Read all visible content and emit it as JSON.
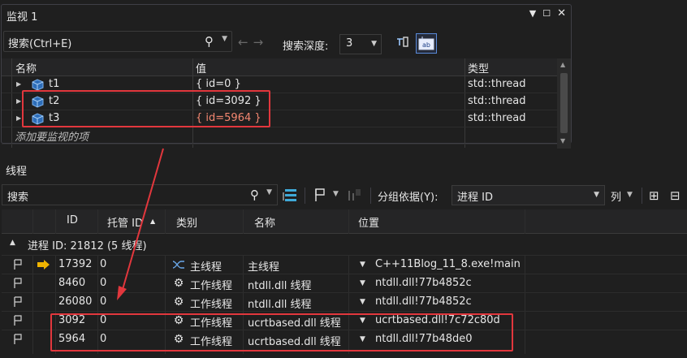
{
  "watch": {
    "title": "监视 1",
    "search_placeholder": "搜索(Ctrl+E)",
    "depth_label": "搜索深度:",
    "depth_value": "3",
    "columns": {
      "name": "名称",
      "value": "值",
      "type": "类型"
    },
    "rows": [
      {
        "name": "t1",
        "value": "{ id=0 }",
        "type": "std::thread",
        "changed": false
      },
      {
        "name": "t2",
        "value": "{ id=3092 }",
        "type": "std::thread",
        "changed": false
      },
      {
        "name": "t3",
        "value": "{ id=5964 }",
        "type": "std::thread",
        "changed": true
      }
    ],
    "add_item": "添加要监视的项",
    "changed_color": "#f48771"
  },
  "threads": {
    "title": "线程",
    "search_placeholder": "搜索",
    "group_by_label": "分组依据(Y):",
    "group_by_value": "进程 ID",
    "columns_label": "列",
    "columns": {
      "id": "ID",
      "managed": "托管 ID",
      "category": "类别",
      "name": "名称",
      "location": "位置"
    },
    "group_header": "进程 ID: 21812  (5 线程)",
    "rows": [
      {
        "id": "17392",
        "managed": "0",
        "category": "主线程",
        "name": "主线程",
        "location": "C++11Blog_11_8.exe!main",
        "current": true
      },
      {
        "id": "8460",
        "managed": "0",
        "category": "工作线程",
        "name": "ntdll.dll 线程",
        "location": "ntdll.dll!77b4852c",
        "current": false
      },
      {
        "id": "26080",
        "managed": "0",
        "category": "工作线程",
        "name": "ntdll.dll 线程",
        "location": "ntdll.dll!77b4852c",
        "current": false
      },
      {
        "id": "3092",
        "managed": "0",
        "category": "工作线程",
        "name": "ucrtbased.dll 线程",
        "location": "ucrtbased.dll!7c72c80d",
        "current": false
      },
      {
        "id": "5964",
        "managed": "0",
        "category": "工作线程",
        "name": "ucrtbased.dll 线程",
        "location": "ntdll.dll!77b48de0",
        "current": false
      }
    ]
  },
  "colors": {
    "background": "#1f1f1f",
    "text": "#e6e6e6",
    "highlight": "#e2373d",
    "accent": "#5a8ad9",
    "current_arrow": "#f0b400"
  },
  "icons": {
    "watch_row": "variable-cube-icon",
    "flag": "flag-icon",
    "current_thread": "current-thread-arrow-icon",
    "main_thread": "main-thread-icon",
    "worker_thread": "gear-icon"
  }
}
